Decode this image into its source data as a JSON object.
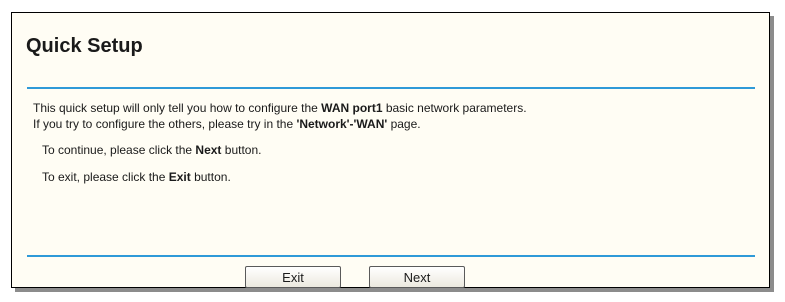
{
  "title": "Quick Setup",
  "intro": {
    "line1_before": "This quick setup will only tell you how to configure the ",
    "line1_bold": "WAN port1",
    "line1_after": " basic network parameters.",
    "line2_before": "If you try to configure the others, please try in the ",
    "line2_bold": "'Network'-'WAN'",
    "line2_after": " page."
  },
  "continue_text": {
    "before": "To continue, please click the ",
    "bold": "Next",
    "after": " button."
  },
  "exit_text": {
    "before": "To exit, please click the ",
    "bold": "Exit",
    "after": " button."
  },
  "buttons": {
    "exit_label": "Exit",
    "next_label": "Next"
  }
}
